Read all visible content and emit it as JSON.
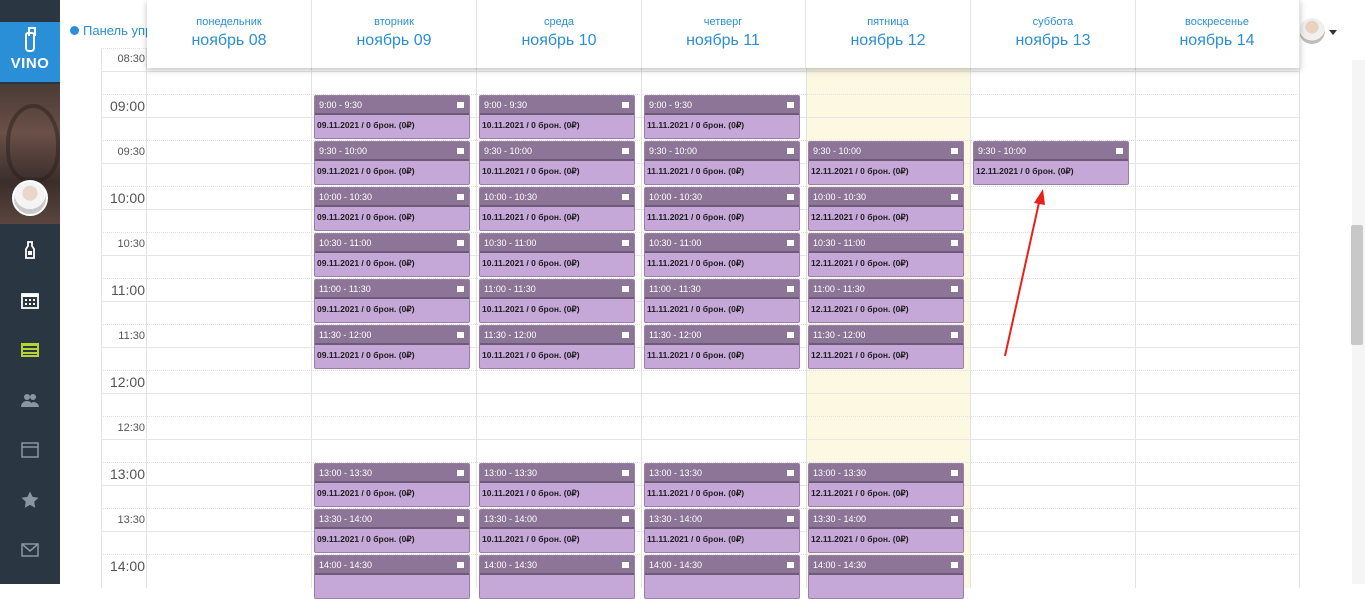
{
  "app": {
    "logo_text": "VINO",
    "panel_link": "Панель упр"
  },
  "sidebar": {
    "items": [
      {
        "icon": "bottle-icon"
      },
      {
        "icon": "calendar-icon"
      },
      {
        "icon": "list-icon"
      },
      {
        "icon": "users-icon"
      },
      {
        "icon": "window-icon"
      },
      {
        "icon": "star-icon"
      },
      {
        "icon": "mail-icon"
      }
    ]
  },
  "calendar": {
    "days": [
      {
        "name": "понедельник",
        "date": "ноябрь 08"
      },
      {
        "name": "вторник",
        "date": "ноябрь 09"
      },
      {
        "name": "среда",
        "date": "ноябрь 10"
      },
      {
        "name": "четверг",
        "date": "ноябрь 11"
      },
      {
        "name": "пятница",
        "date": "ноябрь 12"
      },
      {
        "name": "суббота",
        "date": "ноябрь 13"
      },
      {
        "name": "воскресенье",
        "date": "ноябрь 14"
      }
    ],
    "time_labels": [
      "08:30",
      "09:00",
      "09:30",
      "10:00",
      "10:30",
      "11:00",
      "11:30",
      "12:00",
      "12:30",
      "13:00",
      "13:30",
      "14:00"
    ],
    "events": [
      {
        "time": "9:00 - 9:30",
        "desc": "09.11.2021 / 0 брон. (0₽)"
      },
      {
        "time": "9:00 - 9:30",
        "desc": "10.11.2021 / 0 брон. (0₽)"
      },
      {
        "time": "9:00 - 9:30",
        "desc": "11.11.2021 / 0 брон. (0₽)"
      },
      {
        "time": "9:30 - 10:00",
        "desc": "09.11.2021 / 0 брон. (0₽)"
      },
      {
        "time": "9:30 - 10:00",
        "desc": "10.11.2021 / 0 брон. (0₽)"
      },
      {
        "time": "9:30 - 10:00",
        "desc": "11.11.2021 / 0 брон. (0₽)"
      },
      {
        "time": "9:30 - 10:00",
        "desc": "12.11.2021 / 0 брон. (0₽)"
      },
      {
        "time": "9:30 - 10:00",
        "desc": "12.11.2021 / 0 брон. (0₽)"
      },
      {
        "time": "10:00 - 10:30",
        "desc": "09.11.2021 / 0 брон. (0₽)"
      },
      {
        "time": "10:00 - 10:30",
        "desc": "10.11.2021 / 0 брон. (0₽)"
      },
      {
        "time": "10:00 - 10:30",
        "desc": "11.11.2021 / 0 брон. (0₽)"
      },
      {
        "time": "10:00 - 10:30",
        "desc": "12.11.2021 / 0 брон. (0₽)"
      },
      {
        "time": "10:30 - 11:00",
        "desc": "09.11.2021 / 0 брон. (0₽)"
      },
      {
        "time": "10:30 - 11:00",
        "desc": "10.11.2021 / 0 брон. (0₽)"
      },
      {
        "time": "10:30 - 11:00",
        "desc": "11.11.2021 / 0 брон. (0₽)"
      },
      {
        "time": "10:30 - 11:00",
        "desc": "12.11.2021 / 0 брон. (0₽)"
      },
      {
        "time": "11:00 - 11:30",
        "desc": "09.11.2021 / 0 брон. (0₽)"
      },
      {
        "time": "11:00 - 11:30",
        "desc": "10.11.2021 / 0 брон. (0₽)"
      },
      {
        "time": "11:00 - 11:30",
        "desc": "11.11.2021 / 0 брон. (0₽)"
      },
      {
        "time": "11:00 - 11:30",
        "desc": "12.11.2021 / 0 брон. (0₽)"
      },
      {
        "time": "11:30 - 12:00",
        "desc": "09.11.2021 / 0 брон. (0₽)"
      },
      {
        "time": "11:30 - 12:00",
        "desc": "10.11.2021 / 0 брон. (0₽)"
      },
      {
        "time": "11:30 - 12:00",
        "desc": "11.11.2021 / 0 брон. (0₽)"
      },
      {
        "time": "11:30 - 12:00",
        "desc": "12.11.2021 / 0 брон. (0₽)"
      },
      {
        "time": "13:00 - 13:30",
        "desc": "09.11.2021 / 0 брон. (0₽)"
      },
      {
        "time": "13:00 - 13:30",
        "desc": "10.11.2021 / 0 брон. (0₽)"
      },
      {
        "time": "13:00 - 13:30",
        "desc": "11.11.2021 / 0 брон. (0₽)"
      },
      {
        "time": "13:00 - 13:30",
        "desc": "12.11.2021 / 0 брон. (0₽)"
      },
      {
        "time": "13:30 - 14:00",
        "desc": "09.11.2021 / 0 брон. (0₽)"
      },
      {
        "time": "13:30 - 14:00",
        "desc": "10.11.2021 / 0 брон. (0₽)"
      },
      {
        "time": "13:30 - 14:00",
        "desc": "11.11.2021 / 0 брон. (0₽)"
      },
      {
        "time": "13:30 - 14:00",
        "desc": "12.11.2021 / 0 брон. (0₽)"
      },
      {
        "time": "14:00 - 14:30",
        "desc": ""
      },
      {
        "time": "14:00 - 14:30",
        "desc": ""
      },
      {
        "time": "14:00 - 14:30",
        "desc": ""
      },
      {
        "time": "14:00 - 14:30",
        "desc": ""
      }
    ]
  },
  "colors": {
    "accent": "#2a8fd6",
    "sidebar": "#2b3643",
    "event_fill": "#c5a7d8",
    "event_header": "#8c7596",
    "today_highlight": "#fdf8e1",
    "annotation_arrow": "#e8201a"
  }
}
